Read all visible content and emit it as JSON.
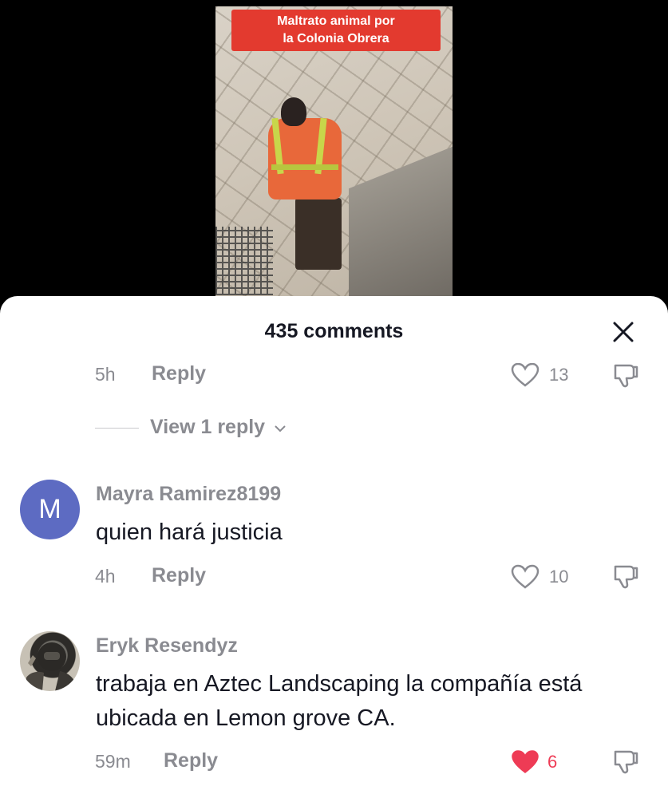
{
  "video": {
    "overlay_title": "Maltrato animal por\nla Colonia Obrera"
  },
  "comments_sheet": {
    "title": "435 comments",
    "close_icon": "close-icon"
  },
  "top_comment_meta": {
    "time": "5h",
    "reply_label": "Reply",
    "like_count": "13",
    "like_icon": "heart-outline-icon",
    "dislike_icon": "thumbs-down-icon"
  },
  "view_replies": {
    "label": "View 1 reply",
    "icon": "chevron-down-icon"
  },
  "comments": [
    {
      "username": "Mayra Ramirez8199",
      "avatar_letter": "M",
      "avatar_color": "#5d6bc2",
      "text": "quien hará justicia",
      "time": "4h",
      "reply_label": "Reply",
      "like_count": "10",
      "liked": false
    },
    {
      "username": "Eryk Resendyz",
      "text": "trabaja en Aztec Landscaping la compañía está ubicada en Lemon grove CA.",
      "time": "59m",
      "reply_label": "Reply",
      "like_count": "6",
      "liked": true,
      "liked_color": "#ee3b55"
    }
  ]
}
